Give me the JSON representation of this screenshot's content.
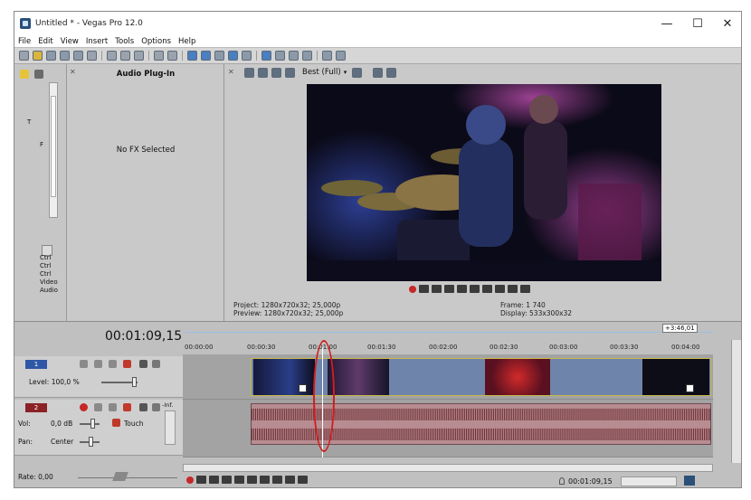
{
  "window": {
    "title": "Untitled * - Vegas Pro 12.0",
    "controls": {
      "minimize": "—",
      "maximize": "☐",
      "close": "✕"
    }
  },
  "menu": [
    "File",
    "Edit",
    "View",
    "Insert",
    "Tools",
    "Options",
    "Help"
  ],
  "left_dock": {
    "items": [
      "Ctrl",
      "Ctrl",
      "Ctrl",
      "Video",
      "Audio"
    ],
    "letters": [
      "T",
      "F"
    ]
  },
  "fx_panel": {
    "title": "Audio Plug-In",
    "empty_text": "No FX Selected"
  },
  "preview": {
    "quality": "Best (Full)",
    "project_label": "Project:",
    "project_value": "1280x720x32; 25,000p",
    "preview_label": "Preview:",
    "preview_value": "1280x720x32; 25,000p",
    "frame_label": "Frame:",
    "frame_value": "1 740",
    "display_label": "Display:",
    "display_value": "533x300x32"
  },
  "timeline": {
    "time": "00:01:09,15",
    "ruler_marker": "+3:46,01",
    "ruler_ticks": [
      "00:00:00",
      "00:00:30",
      "00:01:00",
      "00:01:30",
      "00:02:00",
      "00:02:30",
      "00:03:00",
      "00:03:30",
      "00:04:00"
    ],
    "video_track": {
      "number": "1",
      "level": "Level: 100,0 %"
    },
    "audio_track": {
      "number": "2",
      "vol_label": "Vol:",
      "vol_value": "0,0 dB",
      "pan_label": "Pan:",
      "pan_value": "Center",
      "mode": "Touch",
      "inf": "-Inf."
    },
    "rate": "Rate: 0,00",
    "bottom_time": "00:01:09,15"
  },
  "colors": {
    "accent_red": "#d11d1d",
    "audio_clip": "#b88d91",
    "video_bg": "#0a0a16"
  }
}
